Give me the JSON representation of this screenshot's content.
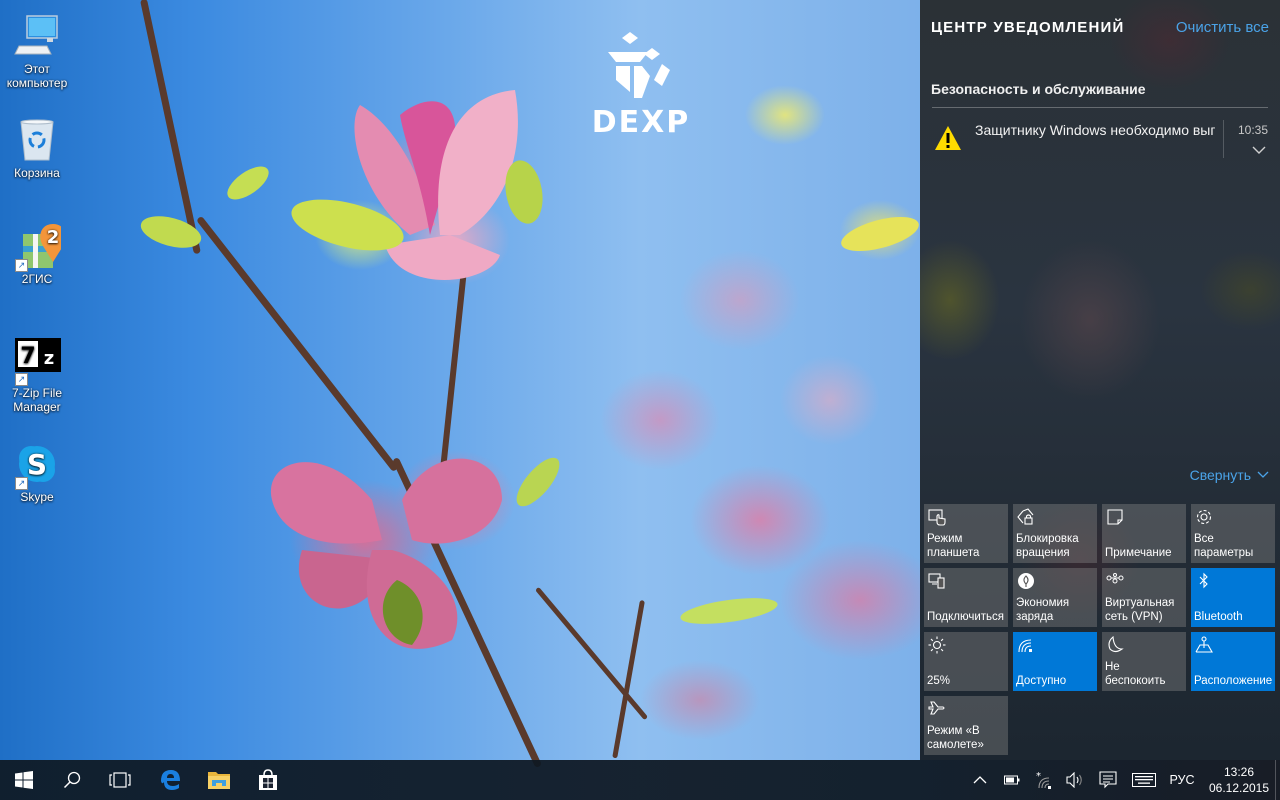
{
  "desktop": {
    "icons": [
      {
        "label": "Этот\nкомпьютер",
        "icon": "this-pc-icon",
        "shortcut": false
      },
      {
        "label": "Корзина",
        "icon": "recycle-bin-icon",
        "shortcut": false
      },
      {
        "label": "2ГИС",
        "icon": "2gis-icon",
        "shortcut": true
      },
      {
        "label": "7-Zip File\nManager",
        "icon": "7zip-icon",
        "shortcut": true
      },
      {
        "label": "Skype",
        "icon": "skype-icon",
        "shortcut": true
      }
    ],
    "wallpaper_logo": "DEXP"
  },
  "action_center": {
    "title": "ЦЕНТР УВЕДОМЛЕНИЙ",
    "clear_all": "Очистить все",
    "groups": [
      {
        "title": "Безопасность и обслуживание",
        "notifications": [
          {
            "icon": "warning-icon",
            "text": "Защитнику Windows необходимо выполнить",
            "time": "10:35"
          }
        ]
      }
    ],
    "collapse": "Свернуть",
    "accent_color": "#0078d7",
    "link_color": "#4aa3e8",
    "quick_actions": [
      {
        "label": "Режим\nпланшета",
        "icon": "tablet-mode-icon",
        "active": false
      },
      {
        "label": "Блокировка\nвращения",
        "icon": "rotation-lock-icon",
        "active": false
      },
      {
        "label": "Примечание",
        "icon": "note-icon",
        "active": false
      },
      {
        "label": "Все\nпараметры",
        "icon": "settings-icon",
        "active": false
      },
      {
        "label": "Подключиться",
        "icon": "connect-icon",
        "active": false
      },
      {
        "label": "Экономия\nзаряда",
        "icon": "battery-saver-icon",
        "active": false
      },
      {
        "label": "Виртуальная\nсеть (VPN)",
        "icon": "vpn-icon",
        "active": false
      },
      {
        "label": "Bluetooth",
        "icon": "bluetooth-icon",
        "active": true
      },
      {
        "label": "25%",
        "icon": "brightness-icon",
        "active": false
      },
      {
        "label": "Доступно",
        "icon": "wifi-icon",
        "active": true
      },
      {
        "label": "Не\nбеспокоить",
        "icon": "quiet-hours-icon",
        "active": false
      },
      {
        "label": "Расположение",
        "icon": "location-icon",
        "active": true
      },
      {
        "label": "Режим «В\nсамолете»",
        "icon": "airplane-mode-icon",
        "active": false
      }
    ]
  },
  "taskbar": {
    "buttons": [
      {
        "name": "start",
        "icon": "windows-logo-icon"
      },
      {
        "name": "search",
        "icon": "search-icon"
      },
      {
        "name": "task-view",
        "icon": "task-view-icon"
      },
      {
        "name": "edge",
        "icon": "edge-icon"
      },
      {
        "name": "file-explorer",
        "icon": "folder-icon"
      },
      {
        "name": "store",
        "icon": "store-icon"
      }
    ],
    "tray": {
      "language": "РУС",
      "time": "13:26",
      "date": "06.12.2015"
    }
  }
}
